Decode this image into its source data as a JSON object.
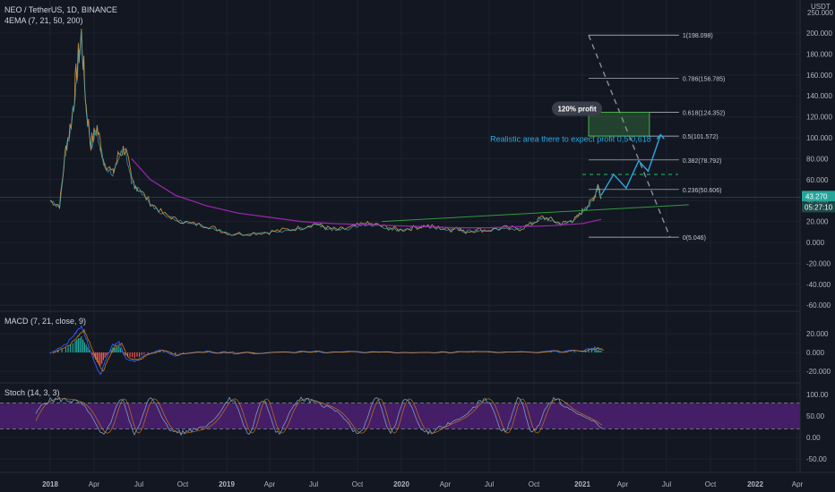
{
  "header": {
    "symbol_line": "NEO / TetherUS, 1D, BINANCE",
    "indicator": "4EMA (7, 21, 50, 200)",
    "currency": "USDT",
    "currency_value": "250.000"
  },
  "colors": {
    "background": "#131722",
    "grid": "#1e222d",
    "axis_text": "#b2b5be",
    "ema_long": "#9c27b0",
    "trendline": "#2e9b3e",
    "forecast": "#29a8e0",
    "dashed": "#8a8f99",
    "fib_line": "#c7c9cf",
    "green_dashed": "#22c55e",
    "current_price_bg": "#26a69a",
    "stoch_band": "#4a1f6e",
    "macd_bar_pos": "#26a69a",
    "macd_bar_neg": "#ef5350",
    "macd_line": "#2962ff",
    "signal_line": "#ff9800"
  },
  "chart_data": [
    {
      "type": "line",
      "name": "price",
      "y_axis_ticks": [
        "200.000",
        "180.000",
        "160.000",
        "140.000",
        "120.000",
        "100.000",
        "80.000",
        "60.000",
        "40.000",
        "20.000",
        "0.000",
        "-20.000",
        "-40.000",
        "-60.000"
      ],
      "ylim": [
        -60,
        200
      ],
      "x_ticks": [
        "2018",
        "Apr",
        "Jul",
        "Oct",
        "2019",
        "Apr",
        "Jul",
        "Oct",
        "2020",
        "Apr",
        "Jul",
        "Oct",
        "2021",
        "Apr",
        "Jul",
        "Oct",
        "2022",
        "Apr"
      ],
      "price_keypoints": [
        [
          0,
          40
        ],
        [
          0.03,
          35
        ],
        [
          0.05,
          90
        ],
        [
          0.07,
          120
        ],
        [
          0.085,
          165
        ],
        [
          0.1,
          198
        ],
        [
          0.115,
          130
        ],
        [
          0.13,
          95
        ],
        [
          0.15,
          110
        ],
        [
          0.17,
          80
        ],
        [
          0.2,
          65
        ],
        [
          0.22,
          85
        ],
        [
          0.24,
          90
        ],
        [
          0.26,
          60
        ],
        [
          0.28,
          52
        ],
        [
          0.32,
          38
        ],
        [
          0.36,
          28
        ],
        [
          0.4,
          22
        ],
        [
          0.45,
          18
        ],
        [
          0.5,
          16
        ],
        [
          0.54,
          12
        ],
        [
          0.58,
          8
        ],
        [
          0.65,
          9
        ],
        [
          0.7,
          10
        ],
        [
          0.75,
          12
        ],
        [
          0.8,
          14
        ],
        [
          0.85,
          18
        ],
        [
          0.88,
          14
        ],
        [
          0.92,
          12
        ],
        [
          0.96,
          14
        ],
        [
          1.0,
          18
        ],
        [
          1.04,
          17
        ],
        [
          1.08,
          14
        ],
        [
          1.12,
          12
        ],
        [
          1.16,
          14
        ],
        [
          1.2,
          16
        ],
        [
          1.24,
          14
        ],
        [
          1.28,
          12
        ],
        [
          1.3,
          15
        ],
        [
          1.32,
          10
        ],
        [
          1.36,
          12
        ],
        [
          1.4,
          12
        ],
        [
          1.45,
          14
        ],
        [
          1.5,
          13
        ],
        [
          1.54,
          18
        ],
        [
          1.57,
          24
        ],
        [
          1.6,
          22
        ],
        [
          1.63,
          18
        ],
        [
          1.66,
          20
        ],
        [
          1.68,
          23
        ],
        [
          1.7,
          30
        ],
        [
          1.72,
          36
        ],
        [
          1.74,
          45
        ],
        [
          1.75,
          55
        ],
        [
          1.76,
          43
        ]
      ],
      "ema200_keypoints": [
        [
          0.26,
          80
        ],
        [
          0.32,
          60
        ],
        [
          0.4,
          45
        ],
        [
          0.5,
          35
        ],
        [
          0.6,
          28
        ],
        [
          0.7,
          24
        ],
        [
          0.8,
          20
        ],
        [
          0.9,
          18
        ],
        [
          1.0,
          17
        ],
        [
          1.1,
          16
        ],
        [
          1.2,
          15
        ],
        [
          1.3,
          14
        ],
        [
          1.4,
          14
        ],
        [
          1.5,
          15
        ],
        [
          1.6,
          16
        ],
        [
          1.7,
          18
        ],
        [
          1.76,
          22
        ]
      ],
      "current_price": "43.270",
      "countdown": "05:27:10",
      "annotation": "Realistic area there to expect profit 0,5-0,618",
      "profit_label": "120% profit",
      "fib_levels": [
        {
          "label": "1(198.098)",
          "value": 198.098
        },
        {
          "label": "0.786(156.785)",
          "value": 156.785
        },
        {
          "label": "0.618(124.352)",
          "value": 124.352
        },
        {
          "label": "0.5(101.572)",
          "value": 101.572
        },
        {
          "label": "0.382(78.792)",
          "value": 78.792
        },
        {
          "label": "0.236(50.606)",
          "value": 50.606
        },
        {
          "label": "0(5.046)",
          "value": 5.046
        }
      ],
      "forecast_path": [
        [
          1.76,
          45
        ],
        [
          1.8,
          65
        ],
        [
          1.84,
          52
        ],
        [
          1.88,
          78
        ],
        [
          1.91,
          68
        ],
        [
          1.95,
          103
        ]
      ],
      "trendline": [
        [
          1.06,
          20
        ],
        [
          2.04,
          36
        ]
      ],
      "dashed_line": [
        [
          1.72,
          198
        ],
        [
          1.98,
          5
        ]
      ],
      "green_level": 65
    },
    {
      "type": "bar",
      "name": "MACD",
      "label": "MACD (7, 21, close, 9)",
      "y_axis_ticks": [
        "20.000",
        "0.000",
        "-20.000"
      ],
      "ylim": [
        -30,
        30
      ],
      "macd_keypoints": [
        [
          0,
          0
        ],
        [
          0.05,
          8
        ],
        [
          0.08,
          20
        ],
        [
          0.1,
          28
        ],
        [
          0.12,
          10
        ],
        [
          0.14,
          -10
        ],
        [
          0.16,
          -24
        ],
        [
          0.18,
          -5
        ],
        [
          0.2,
          8
        ],
        [
          0.22,
          12
        ],
        [
          0.24,
          -6
        ],
        [
          0.27,
          -10
        ],
        [
          0.3,
          -4
        ],
        [
          0.35,
          3
        ],
        [
          0.4,
          -3
        ],
        [
          0.5,
          1
        ],
        [
          0.6,
          -1
        ],
        [
          0.8,
          1
        ],
        [
          1.0,
          0
        ],
        [
          1.2,
          0.5
        ],
        [
          1.4,
          0
        ],
        [
          1.6,
          1
        ],
        [
          1.7,
          2
        ],
        [
          1.74,
          5
        ],
        [
          1.76,
          3
        ]
      ]
    },
    {
      "type": "line",
      "name": "Stoch",
      "label": "Stoch (14, 3, 3)",
      "y_axis_ticks": [
        "100.00",
        "50.00",
        "0.00",
        "-50.00"
      ],
      "ylim": [
        -60,
        110
      ],
      "band": [
        20,
        80
      ]
    }
  ]
}
